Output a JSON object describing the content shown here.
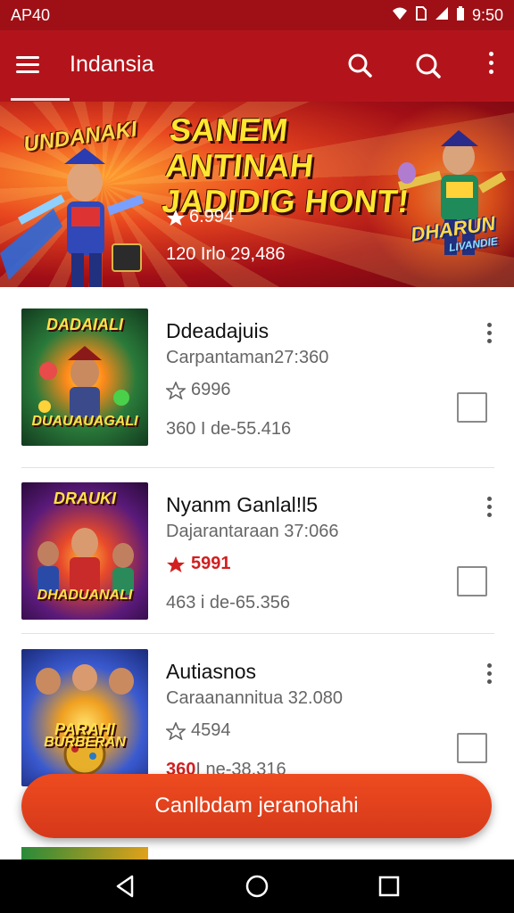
{
  "status_bar": {
    "left_text": "AP40",
    "time": "9:50",
    "icons": [
      "wifi-icon",
      "sim-icon",
      "signal-icon",
      "battery-icon"
    ]
  },
  "app_bar": {
    "title": "Indansia",
    "icons": [
      "menu-icon",
      "search-icon",
      "search-icon",
      "more-vert-icon"
    ]
  },
  "banner": {
    "logo_left": "UNDANAKI",
    "headline_line1": "SANEM ANTINAH",
    "headline_line2": "JADIDIG HONT!",
    "rating": "6.994",
    "downloads": "120 Irlo  29,486",
    "logo_right": "DHARUN",
    "logo_right_sub": "LIVANDIE"
  },
  "apps": [
    {
      "name": "Ddeadajuis",
      "developer": "Carpantaman27:360",
      "rating": "6996",
      "size": "360 I de-55.416",
      "size_prefix_hot": "",
      "thumb_title": "DADAIALI",
      "thumb_sub": "DUAUAUAGALI",
      "rating_highlight": false
    },
    {
      "name": "Nyanm Ganlal!l5",
      "developer": "Dajarantaraan 37:066",
      "rating": "5991",
      "size": "463 i de-65.356",
      "size_prefix_hot": "",
      "thumb_title": "DRAUKI",
      "thumb_sub": "DHADUANALI",
      "rating_highlight": true
    },
    {
      "name": "Autiasnos",
      "developer": "Caraanannitua 32.080",
      "rating": "4594",
      "size": "I ne-38.316",
      "size_prefix_hot": "360",
      "thumb_title": "PARAHI",
      "thumb_sub": "BURBERAN",
      "rating_highlight": false
    }
  ],
  "cta": {
    "label": "Canlbdam jeranohahi"
  },
  "nav_bar": {
    "icons": [
      "back-icon",
      "home-icon",
      "recents-icon"
    ]
  },
  "colors": {
    "status_bar": "#9e1016",
    "app_bar": "#b3141b",
    "accent": "#e2431d",
    "highlight": "#d21f1f"
  }
}
